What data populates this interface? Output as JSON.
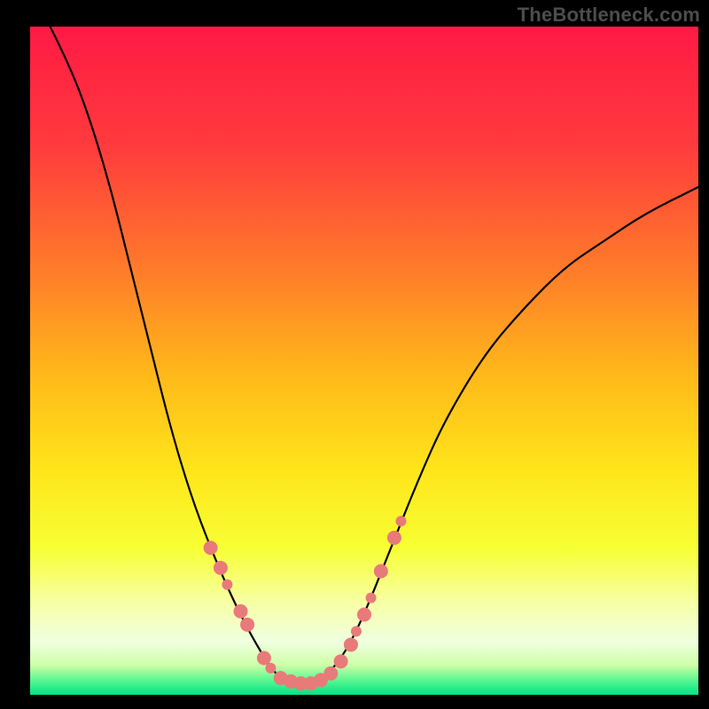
{
  "watermark": "TheBottleneck.com",
  "chart_data": {
    "type": "line",
    "title": "",
    "xlabel": "",
    "ylabel": "",
    "xlim": [
      0,
      100
    ],
    "ylim": [
      0,
      100
    ],
    "background_gradient_stops": [
      {
        "offset": 0.0,
        "color": "#ff1a44"
      },
      {
        "offset": 0.18,
        "color": "#ff3b3d"
      },
      {
        "offset": 0.36,
        "color": "#ff7a2a"
      },
      {
        "offset": 0.52,
        "color": "#ffb81a"
      },
      {
        "offset": 0.66,
        "color": "#ffe41a"
      },
      {
        "offset": 0.78,
        "color": "#f7ff33"
      },
      {
        "offset": 0.86,
        "color": "#f7ffa3"
      },
      {
        "offset": 0.92,
        "color": "#f0ffe0"
      },
      {
        "offset": 0.955,
        "color": "#cfffa8"
      },
      {
        "offset": 0.98,
        "color": "#52f58f"
      },
      {
        "offset": 1.0,
        "color": "#00e286"
      }
    ],
    "curve": {
      "minimum_x": 40,
      "points": [
        {
          "x": 3,
          "y": 100
        },
        {
          "x": 6,
          "y": 94
        },
        {
          "x": 9,
          "y": 86
        },
        {
          "x": 12,
          "y": 76
        },
        {
          "x": 15,
          "y": 64
        },
        {
          "x": 18,
          "y": 52
        },
        {
          "x": 21,
          "y": 40
        },
        {
          "x": 24,
          "y": 30
        },
        {
          "x": 27,
          "y": 22
        },
        {
          "x": 30,
          "y": 15
        },
        {
          "x": 33,
          "y": 9
        },
        {
          "x": 36,
          "y": 4
        },
        {
          "x": 38,
          "y": 2
        },
        {
          "x": 40,
          "y": 1.5
        },
        {
          "x": 42,
          "y": 1.5
        },
        {
          "x": 44,
          "y": 2.5
        },
        {
          "x": 47,
          "y": 6
        },
        {
          "x": 50,
          "y": 12
        },
        {
          "x": 54,
          "y": 22
        },
        {
          "x": 58,
          "y": 32
        },
        {
          "x": 62,
          "y": 41
        },
        {
          "x": 68,
          "y": 51
        },
        {
          "x": 74,
          "y": 58
        },
        {
          "x": 80,
          "y": 64
        },
        {
          "x": 86,
          "y": 68
        },
        {
          "x": 92,
          "y": 72
        },
        {
          "x": 100,
          "y": 76
        }
      ]
    },
    "series": [
      {
        "name": "markers",
        "color": "#e87a7a",
        "radius_large": 8,
        "radius_small": 6,
        "points": [
          {
            "x": 27.0,
            "y": 22.0,
            "r": "large"
          },
          {
            "x": 28.5,
            "y": 19.0,
            "r": "large"
          },
          {
            "x": 29.5,
            "y": 16.5,
            "r": "small"
          },
          {
            "x": 31.5,
            "y": 12.5,
            "r": "large"
          },
          {
            "x": 32.5,
            "y": 10.5,
            "r": "large"
          },
          {
            "x": 35.0,
            "y": 5.5,
            "r": "large"
          },
          {
            "x": 36.0,
            "y": 4.0,
            "r": "small"
          },
          {
            "x": 37.5,
            "y": 2.5,
            "r": "large"
          },
          {
            "x": 39.0,
            "y": 2.0,
            "r": "large"
          },
          {
            "x": 40.5,
            "y": 1.7,
            "r": "large"
          },
          {
            "x": 42.0,
            "y": 1.7,
            "r": "large"
          },
          {
            "x": 43.5,
            "y": 2.2,
            "r": "large"
          },
          {
            "x": 45.0,
            "y": 3.2,
            "r": "large"
          },
          {
            "x": 46.5,
            "y": 5.0,
            "r": "large"
          },
          {
            "x": 48.0,
            "y": 7.5,
            "r": "large"
          },
          {
            "x": 48.8,
            "y": 9.5,
            "r": "small"
          },
          {
            "x": 50.0,
            "y": 12.0,
            "r": "large"
          },
          {
            "x": 51.0,
            "y": 14.5,
            "r": "small"
          },
          {
            "x": 52.5,
            "y": 18.5,
            "r": "large"
          },
          {
            "x": 54.5,
            "y": 23.5,
            "r": "large"
          },
          {
            "x": 55.5,
            "y": 26.0,
            "r": "small"
          }
        ]
      }
    ]
  }
}
